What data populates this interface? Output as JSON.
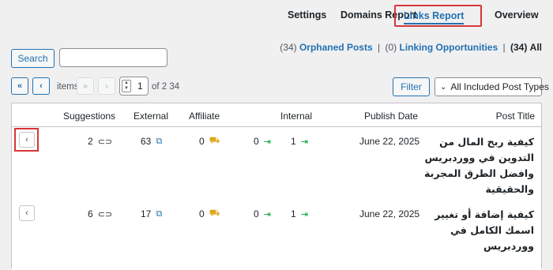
{
  "tabs": {
    "settings": "Settings",
    "domains": "Domains Report",
    "links": "Links Report",
    "overview": "Overview"
  },
  "filters": {
    "orphaned_count": "(34)",
    "orphaned_label": "Orphaned Posts",
    "linking_count": "(0)",
    "linking_label": "Linking Opportunities",
    "all_count": "(34)",
    "all_label": "All",
    "separator": "|"
  },
  "search": {
    "button": "Search",
    "placeholder": ""
  },
  "pagination": {
    "first": "«",
    "prev": "‹",
    "items_label": "items",
    "last": "»",
    "next": "›",
    "current_page": "1",
    "of_label": "of 2",
    "total_items": "34"
  },
  "toolbar": {
    "filter_button": "Filter",
    "post_type_select": "All Included Post Types"
  },
  "table": {
    "headers": {
      "suggestions": "Suggestions",
      "external": "External",
      "affiliate": "Affiliate",
      "internal": "Internal",
      "publish_date": "Publish Date",
      "post_title": "Post Title"
    },
    "rows": [
      {
        "expand": "‹",
        "suggestions": "2",
        "external": "63",
        "affiliate": "0",
        "internal_in": "0",
        "internal_out": "1",
        "publish_date": "June 22, 2025",
        "title": "كيفية ربح المال من التدوين في ووردبريس وافضل الطرق المجربة والحقيقية"
      },
      {
        "expand": "‹",
        "suggestions": "6",
        "external": "17",
        "affiliate": "0",
        "internal_in": "0",
        "internal_out": "1",
        "publish_date": "June 22, 2025",
        "title": "كيفية إضافة أو تغيير اسمك الكامل في ووردبريس"
      }
    ]
  },
  "icons": {
    "link": "link-icon",
    "external": "external-link-icon",
    "cart": "cart-icon",
    "internal": "internal-link-icon"
  },
  "colors": {
    "accent": "#2271b1",
    "highlight": "#d63638",
    "affiliate": "#dba617",
    "internal": "#00a32a"
  }
}
